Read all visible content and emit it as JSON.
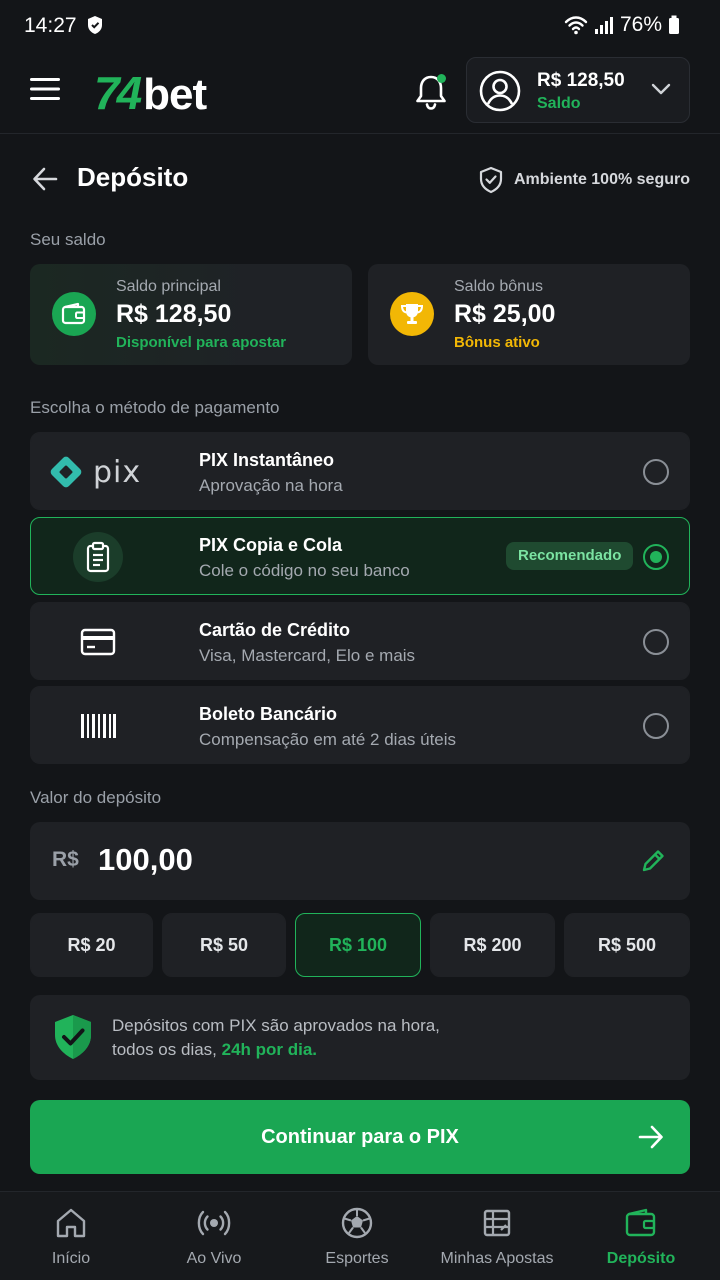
{
  "status_bar": {
    "time": "14:27",
    "battery": "76%"
  },
  "header": {
    "logo_number": "74",
    "logo_text": "bet",
    "account_balance": "R$ 128,50",
    "account_label": "Saldo"
  },
  "page": {
    "title": "Depósito",
    "secure_label": "Ambiente 100% seguro"
  },
  "balance": {
    "section_label": "Seu saldo",
    "main": {
      "title": "Saldo principal",
      "value": "R$ 128,50",
      "sub": "Disponível para apostar"
    },
    "bonus": {
      "title": "Saldo bônus",
      "value": "R$ 25,00",
      "sub": "Bônus ativo"
    }
  },
  "payment": {
    "section_label": "Escolha o método de pagamento",
    "methods": [
      {
        "title": "PIX Instantâneo",
        "sub": "Aprovação na hora",
        "icon": "pix-logo-icon",
        "logo_text": "pix",
        "selected": false
      },
      {
        "title": "PIX Copia e Cola",
        "sub": "Cole o código no seu banco",
        "icon": "clipboard-icon",
        "badge": "Recomendado",
        "selected": true
      },
      {
        "title": "Cartão de Crédito",
        "sub": "Visa, Mastercard, Elo e mais",
        "icon": "credit-card-icon",
        "selected": false
      },
      {
        "title": "Boleto Bancário",
        "sub": "Compensação em até 2 dias úteis",
        "icon": "barcode-icon",
        "selected": false
      }
    ]
  },
  "deposit": {
    "section_label": "Valor do depósito",
    "currency": "R$",
    "value": "100,00",
    "quick_amounts": [
      "R$ 20",
      "R$ 50",
      "R$ 100",
      "R$ 200",
      "R$ 500"
    ],
    "selected_amount": "R$ 100"
  },
  "info": {
    "line1": "Depósitos com PIX são aprovados na hora,",
    "line2_prefix": "todos os dias, ",
    "line2_highlight": "24h por dia."
  },
  "cta": {
    "label": "Continuar para o PIX"
  },
  "bottom_nav": {
    "items": [
      {
        "label": "Início",
        "icon": "home-icon"
      },
      {
        "label": "Ao Vivo",
        "icon": "live-icon"
      },
      {
        "label": "Esportes",
        "icon": "soccer-ball-icon"
      },
      {
        "label": "Minhas Apostas",
        "icon": "bet-slip-icon"
      },
      {
        "label": "Depósito",
        "icon": "wallet-icon",
        "active": true
      }
    ]
  },
  "colors": {
    "accent": "#21b35a",
    "background": "#131518",
    "card": "#1f2125",
    "bonus": "#f2b705"
  }
}
